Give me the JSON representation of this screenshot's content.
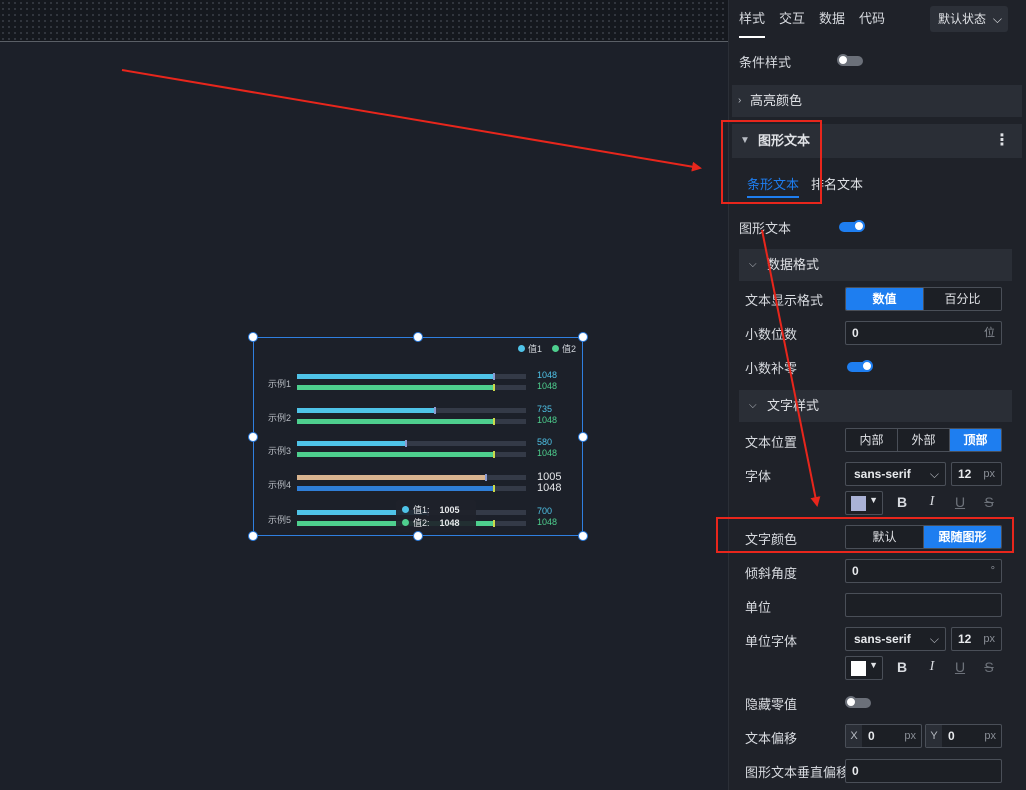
{
  "panel": {
    "tabs": [
      "样式",
      "交互",
      "数据",
      "代码"
    ],
    "state_select": "默认状态",
    "condition_style_label": "条件样式",
    "highlight_color_label": "高亮颜色",
    "graphic_text_label": "图形文本",
    "subtabs": [
      "条形文本",
      "排名文本"
    ],
    "graphic_text_toggle_label": "图形文本",
    "data_format": {
      "title": "数据格式",
      "display_format_label": "文本显示格式",
      "display_format_options": [
        "数值",
        "百分比"
      ],
      "decimals_label": "小数位数",
      "decimals_value": "0",
      "decimals_unit": "位",
      "zero_pad_label": "小数补零"
    },
    "text_style": {
      "title": "文字样式",
      "position_label": "文本位置",
      "position_options": [
        "内部",
        "外部",
        "顶部"
      ],
      "font_label": "字体",
      "font_family": "sans-serif",
      "font_size": "12",
      "font_unit": "px",
      "text_color_label": "文字颜色",
      "text_color_options": [
        "默认",
        "跟随图形"
      ],
      "swatch_color": "#aab2d6",
      "tilt_label": "倾斜角度",
      "tilt_value": "0",
      "tilt_unit": "°",
      "unit_label": "单位",
      "unit_value": "",
      "unit_font_label": "单位字体",
      "unit_font_family": "sans-serif",
      "unit_font_size": "12",
      "unit_font_unit": "px",
      "unit_swatch_color": "#ffffff",
      "hide_zero_label": "隐藏零值",
      "offset_label": "文本偏移",
      "offset_x_tag": "X",
      "offset_x": "0",
      "offset_y_tag": "Y",
      "offset_y": "0",
      "offset_unit": "px",
      "vertical_offset_label": "图形文本垂直偏移",
      "vertical_offset": "0"
    },
    "format_buttons": [
      "B",
      "I",
      "U",
      "S"
    ]
  },
  "chart_data": {
    "type": "bar",
    "orientation": "horizontal",
    "categories": [
      "示例1",
      "示例2",
      "示例3",
      "示例4",
      "示例5"
    ],
    "series": [
      {
        "name": "值1",
        "values": [
          1048,
          735,
          580,
          1005,
          700
        ],
        "color": "#4fc3e8"
      },
      {
        "name": "值2",
        "values": [
          1048,
          1048,
          1048,
          1048,
          1048
        ],
        "color": "#4ecf8e"
      }
    ],
    "highlight_category": "示例4",
    "highlight_colors": {
      "series1": "#d9b48f",
      "series2": "#2f7fd8"
    },
    "xlim": [
      0,
      1220
    ],
    "legend": "top-right",
    "tooltip": {
      "rows": [
        {
          "name": "值1:",
          "value": "1005"
        },
        {
          "name": "值2:",
          "value": "1048"
        }
      ]
    }
  },
  "colors": {
    "accent": "#1e7ef0",
    "annotation_red": "#e8261c"
  }
}
